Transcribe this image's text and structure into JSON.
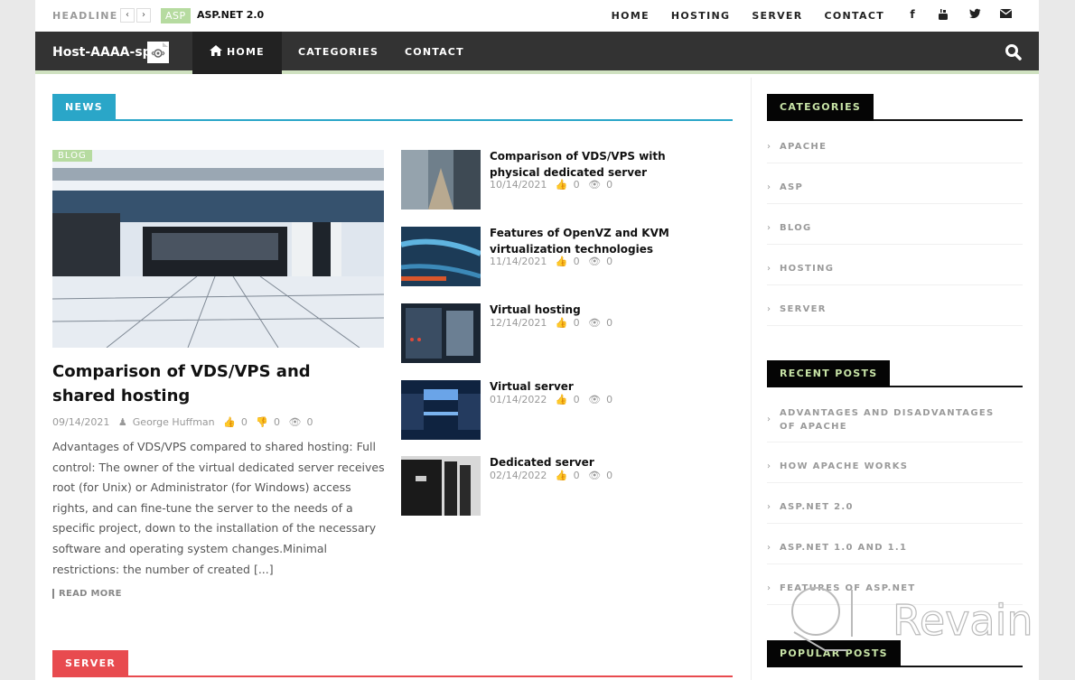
{
  "topbar": {
    "headline_label": "HEADLINE",
    "prev_arrow": "‹",
    "next_arrow": "›",
    "headline_badge": "ASP",
    "headline_title": "ASP.NET 2.0",
    "nav": [
      "HOME",
      "HOSTING",
      "SERVER",
      "CONTACT"
    ],
    "social": [
      {
        "name": "facebook-icon",
        "glyph": "f"
      },
      {
        "name": "youtube-icon",
        "glyph": "▶"
      },
      {
        "name": "twitter-icon",
        "glyph": "🐦"
      },
      {
        "name": "email-icon",
        "glyph": "✉"
      }
    ]
  },
  "mainnav": {
    "logo": "Host-AAAA-sp",
    "logo_icon": "⚙",
    "items": [
      "HOME",
      "CATEGORIES",
      "CONTACT"
    ],
    "home_icon": "⌂"
  },
  "colors": {
    "news": "#2aa6c8",
    "server": "#e84b4f",
    "badge": "#b6dba0",
    "nav_bg": "#333333",
    "widget_title": "#c7e3a6"
  },
  "news": {
    "section_title": "NEWS",
    "featured": {
      "badge": "BLOG",
      "title": "Comparison of VDS/VPS and shared hosting",
      "date": "09/14/2021",
      "author": "George Huffman",
      "likes": "0",
      "dislikes": "0",
      "views": "0",
      "excerpt": "Advantages of VDS/VPS compared to shared hosting: Full control: The owner of the virtual dedicated server receives root (for Unix) or Administrator (for Windows) access rights, and can fine-tune the server to the needs of a specific project, down to the installation of the necessary software and operating system changes.Minimal restrictions: the number of created [...]",
      "read_more": "READ MORE"
    },
    "posts": [
      {
        "title": "Comparison of VDS/VPS with physical dedicated server",
        "date": "10/14/2021",
        "likes": "0",
        "views": "0"
      },
      {
        "title": "Features of OpenVZ and KVM virtualization technologies",
        "date": "11/14/2021",
        "likes": "0",
        "views": "0"
      },
      {
        "title": "Virtual hosting",
        "date": "12/14/2021",
        "likes": "0",
        "views": "0"
      },
      {
        "title": "Virtual server",
        "date": "01/14/2022",
        "likes": "0",
        "views": "0"
      },
      {
        "title": "Dedicated server",
        "date": "02/14/2022",
        "likes": "0",
        "views": "0"
      }
    ]
  },
  "server_section": {
    "title": "SERVER"
  },
  "sidebar": {
    "categories_title": "CATEGORIES",
    "categories": [
      "APACHE",
      "ASP",
      "BLOG",
      "HOSTING",
      "SERVER"
    ],
    "recent_title": "RECENT POSTS",
    "recent": [
      "ADVANTAGES AND DISADVANTAGES OF APACHE",
      "HOW APACHE WORKS",
      "ASP.NET 2.0",
      "ASP.NET 1.0 AND 1.1",
      "FEATURES OF ASP.NET"
    ],
    "popular_title": "POPULAR POSTS",
    "chevron": "›"
  },
  "watermark": "Revain"
}
